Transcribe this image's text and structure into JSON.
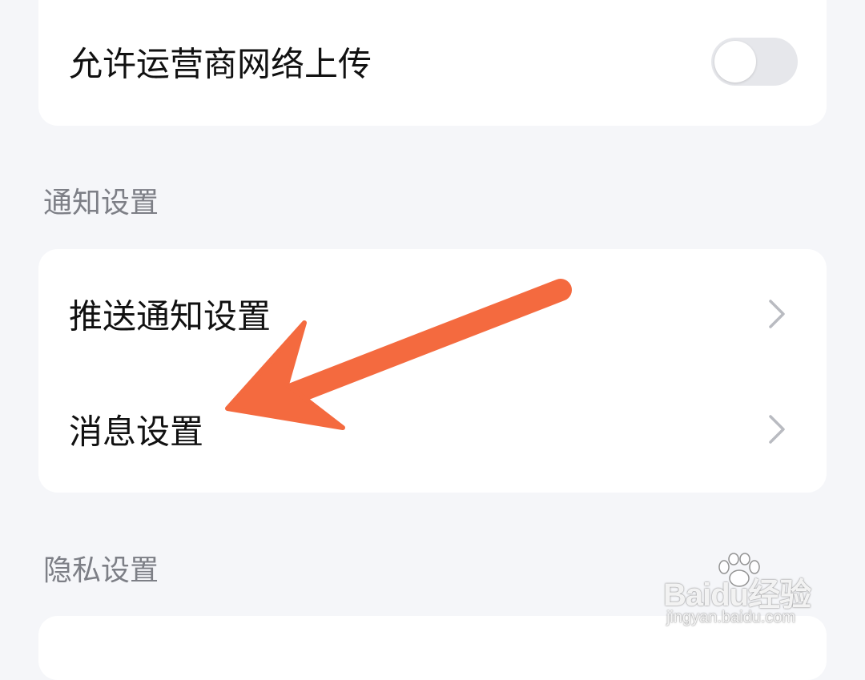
{
  "network": {
    "allow_carrier_upload_label": "允许运营商网络上传",
    "allow_carrier_upload_on": false
  },
  "notification_section": {
    "title": "通知设置",
    "items": [
      {
        "label": "推送通知设置"
      },
      {
        "label": "消息设置"
      }
    ]
  },
  "privacy_section": {
    "title": "隐私设置"
  },
  "watermark": {
    "brand": "Baidu经验",
    "url": "jingyan.baidu.com"
  },
  "colors": {
    "background": "#f5f6f9",
    "card": "#ffffff",
    "text_primary": "#111111",
    "text_secondary": "#7d7f86",
    "toggle_off": "#e6e7eb",
    "arrow_annotation": "#f46a3f"
  },
  "icons": {
    "row_chevron": "chevron-right-icon",
    "annotation_arrow": "arrow-annotation-icon"
  }
}
